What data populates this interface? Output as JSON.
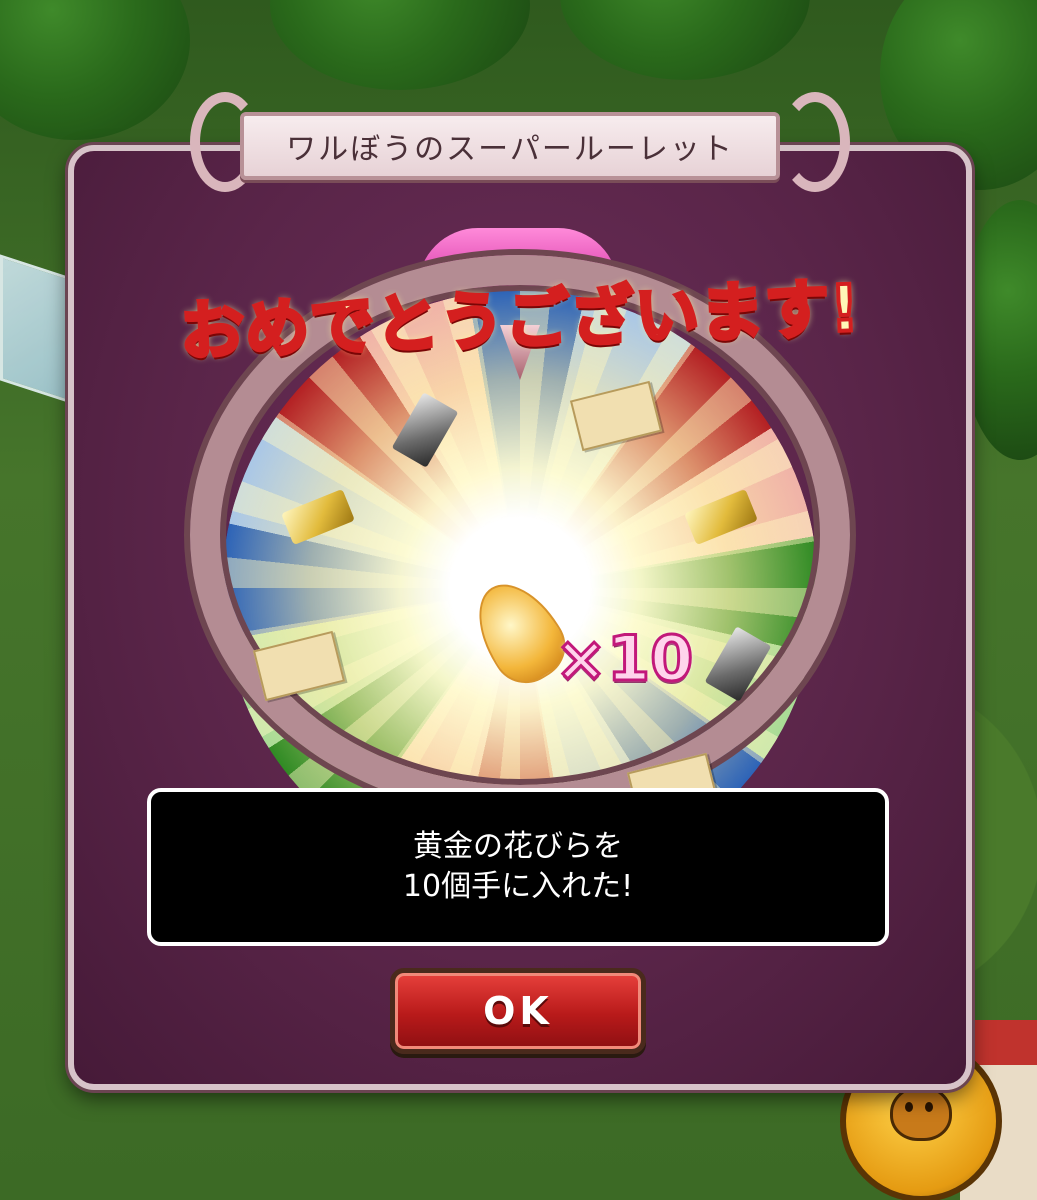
{
  "dialog": {
    "title": "ワルぼうのスーパールーレット",
    "banner": "おめでとうございます!",
    "reward": {
      "item_icon": "golden-petal-icon",
      "multiplier": "×10"
    },
    "message": {
      "line1": "黄金の花びらを",
      "line2": "10個手に入れた!"
    },
    "ok_label": "OK"
  },
  "wheel_prizes": [
    "ticket-icon",
    "silver-bar-icon",
    "gold-bar-icon",
    "ticket-icon",
    "gold-bar-icon",
    "silver-bar-icon",
    "ticket-icon"
  ],
  "colors": {
    "dialog_bg": "#5a2549",
    "banner_text": "#fff8b8",
    "banner_outline": "#d41f1f",
    "multiplier_outline": "#c2187a",
    "ok_button": "#b81a1a"
  }
}
